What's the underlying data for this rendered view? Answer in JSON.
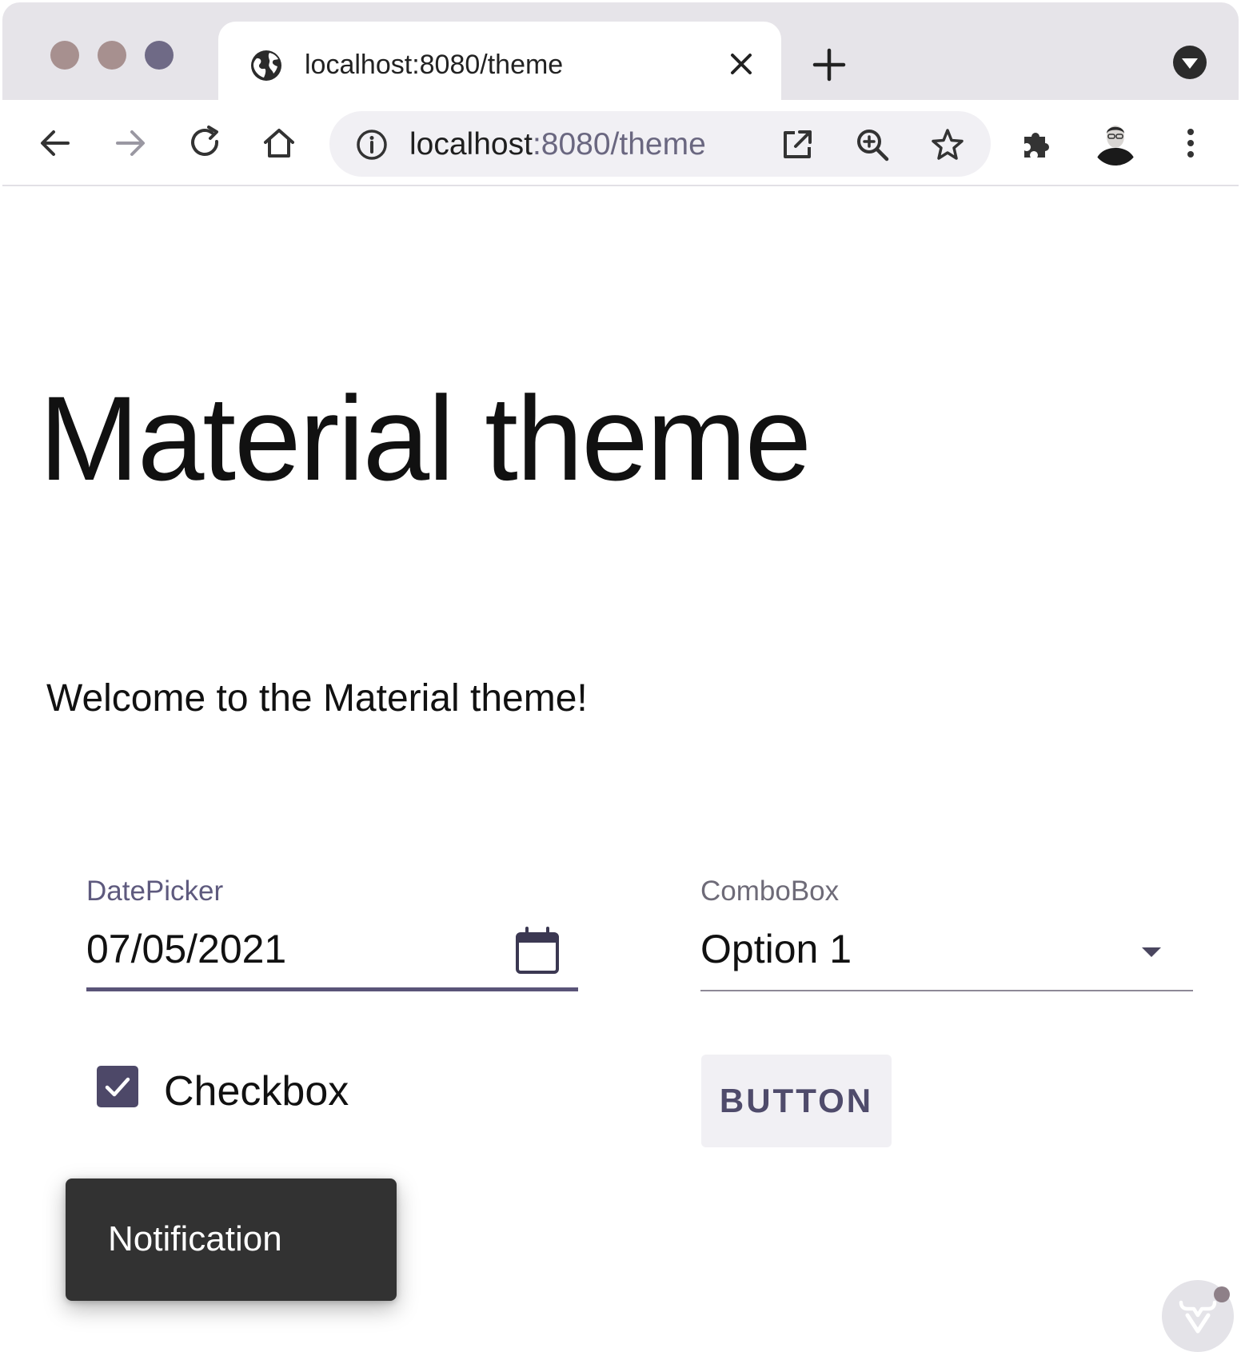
{
  "browser": {
    "tab": {
      "title": "localhost:8080/theme"
    },
    "omnibox": {
      "host": "localhost",
      "rest": ":8080/theme"
    }
  },
  "page": {
    "title": "Material theme",
    "welcome": "Welcome to the Material theme!",
    "datepicker": {
      "label": "DatePicker",
      "value": "07/05/2021"
    },
    "combobox": {
      "label": "ComboBox",
      "value": "Option 1"
    },
    "checkbox": {
      "label": "Checkbox",
      "checked": true
    },
    "button": {
      "label": "BUTTON"
    },
    "notification": {
      "text": "Notification"
    }
  },
  "colors": {
    "accent": "#5a5478",
    "notification_bg": "#323232",
    "tabstrip_bg": "#e6e4e9"
  }
}
